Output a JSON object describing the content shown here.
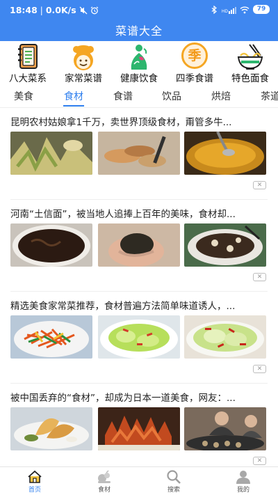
{
  "status_bar": {
    "time": "18:48",
    "network_speed": "0.0K/s",
    "signal_label": "HD",
    "battery": "79",
    "icons": [
      "mute-icon",
      "alarm-icon",
      "bluetooth-icon",
      "signal-icon",
      "wifi-icon",
      "battery-icon"
    ]
  },
  "app_bar": {
    "title": "菜谱大全"
  },
  "categories": [
    {
      "label": "八大菜系",
      "icon": "recipe-book-icon"
    },
    {
      "label": "家常菜谱",
      "icon": "chef-face-icon"
    },
    {
      "label": "健康饮食",
      "icon": "healthy-person-icon"
    },
    {
      "label": "四季食谱",
      "icon": "season-badge-icon",
      "icon_text": "季"
    },
    {
      "label": "特色面食",
      "icon": "noodle-bowl-icon"
    }
  ],
  "tabs": {
    "items": [
      "美食",
      "食材",
      "食谱",
      "饮品",
      "烘焙",
      "茶道"
    ],
    "active": "食材"
  },
  "feed": {
    "articles": [
      {
        "title": "昆明农村姑娘拿1千万，卖世界顶级食材，甭管多牛...",
        "close_icon": "close-icon"
      },
      {
        "title": "河南“土信面”，被当地人追捧上百年的美味，食材却...",
        "close_icon": "close-icon"
      },
      {
        "title": "精选美食家常菜推荐，食材普遍方法简单味道诱人，...",
        "close_icon": "close-icon"
      },
      {
        "title": "被中国丢弃的“食材”，却成为日本一道美食，网友：...",
        "close_icon": "close-icon"
      }
    ]
  },
  "bottom_nav": {
    "items": [
      {
        "label": "首页",
        "icon": "home-icon"
      },
      {
        "label": "食材",
        "icon": "ingredients-icon"
      },
      {
        "label": "搜索",
        "icon": "search-icon"
      },
      {
        "label": "我的",
        "icon": "profile-icon"
      }
    ],
    "active": "首页"
  },
  "colors": {
    "primary": "#3f87f0",
    "active_tab": "#2f7fee",
    "orange_accent": "#f5a623",
    "green_accent": "#2db66e"
  }
}
